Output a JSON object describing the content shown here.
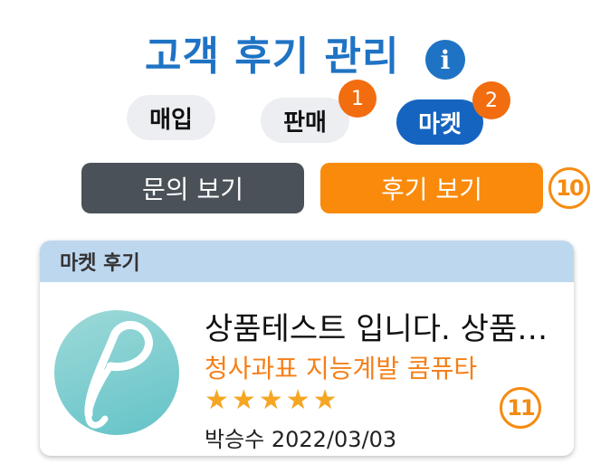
{
  "header": {
    "title": "고객 후기 관리",
    "info_icon": "i"
  },
  "tabs": [
    {
      "label": "매입",
      "badge": ""
    },
    {
      "label": "판매",
      "badge": "1"
    },
    {
      "label": "마켓",
      "badge": "2",
      "active": true
    }
  ],
  "actions": {
    "inquiry_label": "문의 보기",
    "review_label": "후기 보기"
  },
  "callouts": {
    "ten": "10",
    "eleven": "11"
  },
  "card": {
    "header": "마켓 후기",
    "review_title": "상품테스트 입니다. 상품테스트",
    "product_name": "청사과표 지능계발 콤퓨타",
    "rating": 5,
    "rating_max": 5,
    "author_date": "박승수 2022/03/03"
  },
  "colors": {
    "primary": "#1f73c4",
    "accent": "#f68b11",
    "dark_button": "#4a5158",
    "card_header": "#bdd7ef",
    "badge": "#f26d0f"
  }
}
